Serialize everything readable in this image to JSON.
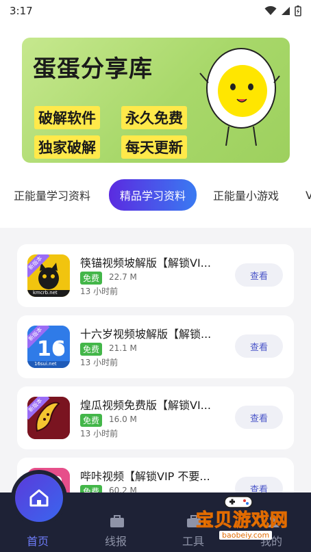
{
  "status_bar": {
    "time": "3:17"
  },
  "banner": {
    "title": "蛋蛋分享库",
    "tags": [
      "破解软件",
      "永久免费",
      "独家破解",
      "每天更新"
    ]
  },
  "tabs": [
    {
      "label": "正能量学习资料",
      "active": false
    },
    {
      "label": "精品学习资料",
      "active": true
    },
    {
      "label": "正能量小游戏",
      "active": false
    },
    {
      "label": "V",
      "active": false
    }
  ],
  "apps": [
    {
      "title": "筷锚视频坡解版【解锁VI...",
      "badge": "免费",
      "size": "22.7 M",
      "time": "13 小时前",
      "button": "查看",
      "icon": "cat-icon",
      "icon_color": "#f1c40f",
      "ribbon": "新版本",
      "icon_caption": "kmcrb.net"
    },
    {
      "title": "十六岁视频坡解版【解锁...",
      "badge": "免费",
      "size": "21.1 M",
      "time": "13 小时前",
      "button": "查看",
      "icon": "number-16-icon",
      "icon_color": "#2f7be8",
      "ribbon": "新版本",
      "icon_caption": "16sui.net"
    },
    {
      "title": "煌瓜视频免费版【解锁VI...",
      "badge": "免费",
      "size": "16.0 M",
      "time": "13 小时前",
      "button": "查看",
      "icon": "banana-icon",
      "icon_color": "#7a1420",
      "ribbon": "新版本",
      "icon_caption": ""
    },
    {
      "title": "哔咔视频【解锁VIP 不要...",
      "badge": "免费",
      "size": "60.2 M",
      "time": "",
      "button": "查看",
      "icon": "pika-icon",
      "icon_color": "#e64f8a",
      "ribbon": "",
      "icon_caption": ""
    }
  ],
  "bottom_nav": [
    {
      "label": "首页",
      "icon": "home-icon",
      "active": true
    },
    {
      "label": "线报",
      "icon": "bag-icon",
      "active": false
    },
    {
      "label": "工具",
      "icon": "toolbox-icon",
      "active": false
    },
    {
      "label": "我的",
      "icon": "user-icon",
      "active": false
    }
  ],
  "watermark": {
    "text": "宝贝游戏网",
    "url": "baobeiy.com"
  },
  "colors": {
    "accent_start": "#5b2be0",
    "accent_end": "#3a7af2",
    "free_green": "#43b649",
    "nav_bg": "#1e2236"
  }
}
